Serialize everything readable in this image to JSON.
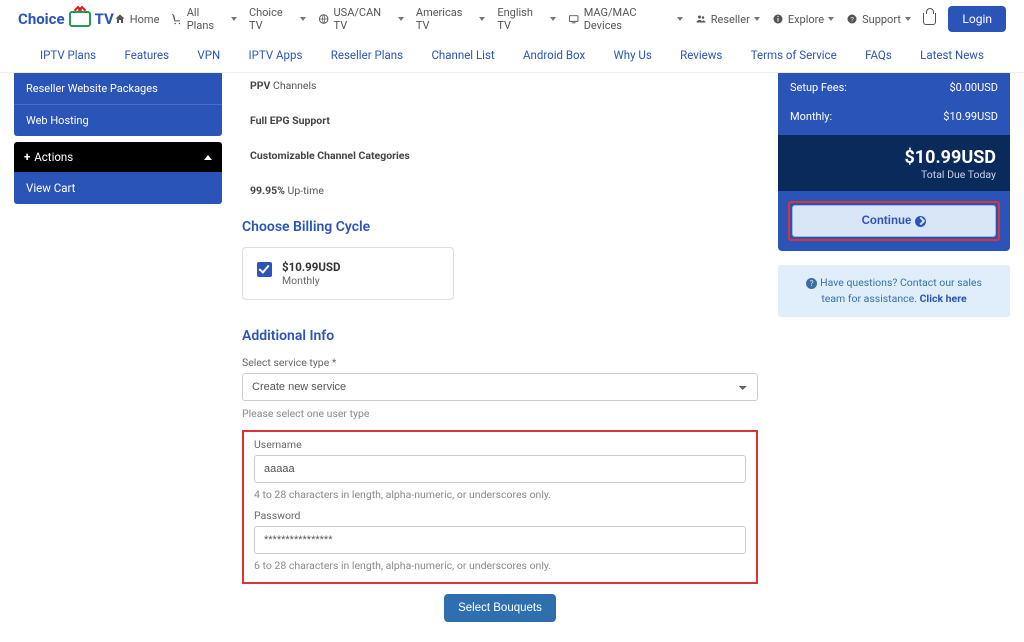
{
  "logo": {
    "part1": "Choice",
    "part2": "TV"
  },
  "topnav": [
    {
      "label": "Home"
    },
    {
      "label": "All Plans",
      "dd": true
    },
    {
      "label": "Choice TV",
      "dd": true
    },
    {
      "label": "USA/CAN TV",
      "dd": true
    },
    {
      "label": "Americas TV",
      "dd": true
    },
    {
      "label": "English TV",
      "dd": true
    },
    {
      "label": "MAG/MAC Devices",
      "dd": true
    },
    {
      "label": "Reseller",
      "dd": true
    },
    {
      "label": "Explore",
      "dd": true
    },
    {
      "label": "Support",
      "dd": true
    }
  ],
  "login": "Login",
  "secnav": [
    "IPTV Plans",
    "Features",
    "VPN",
    "IPTV Apps",
    "Reseller Plans",
    "Channel List",
    "Android Box",
    "Why Us",
    "Reviews",
    "Terms of Service",
    "FAQs",
    "Latest News"
  ],
  "sidebar": {
    "items": [
      "Reseller Website Packages",
      "Web Hosting"
    ],
    "actions_header": "Actions",
    "view_cart": "View Cart"
  },
  "features": [
    {
      "b": "PPV",
      "rest": " Channels"
    },
    {
      "b": "Full EPG Support",
      "rest": ""
    },
    {
      "b": "Customizable Channel Categories",
      "rest": ""
    },
    {
      "b": "99.95%",
      "rest": " Up-time"
    }
  ],
  "billing": {
    "title": "Choose Billing Cycle",
    "price": "$10.99USD",
    "cycle": "Monthly"
  },
  "additional": {
    "title": "Additional Info",
    "service_label": "Select service type *",
    "service_value": "Create new service",
    "user_hint": "Please select one user type",
    "username_label": "Username",
    "username_value": "aaaaa",
    "username_hint": "4 to 28 characters in length, alpha-numeric, or underscores only.",
    "password_label": "Password",
    "password_value": "****************",
    "password_hint": "6 to 28 characters in length, alpha-numeric, or underscores only.",
    "select_bouquets": "Select Bouquets"
  },
  "summary": {
    "setup_label": "Setup Fees:",
    "setup_value": "$0.00USD",
    "monthly_label": "Monthly:",
    "monthly_value": "$10.99USD",
    "total_value": "$10.99USD",
    "total_label": "Total Due Today",
    "continue": "Continue"
  },
  "help": {
    "text": "Have questions? Contact our sales team for assistance. ",
    "link": "Click here"
  }
}
